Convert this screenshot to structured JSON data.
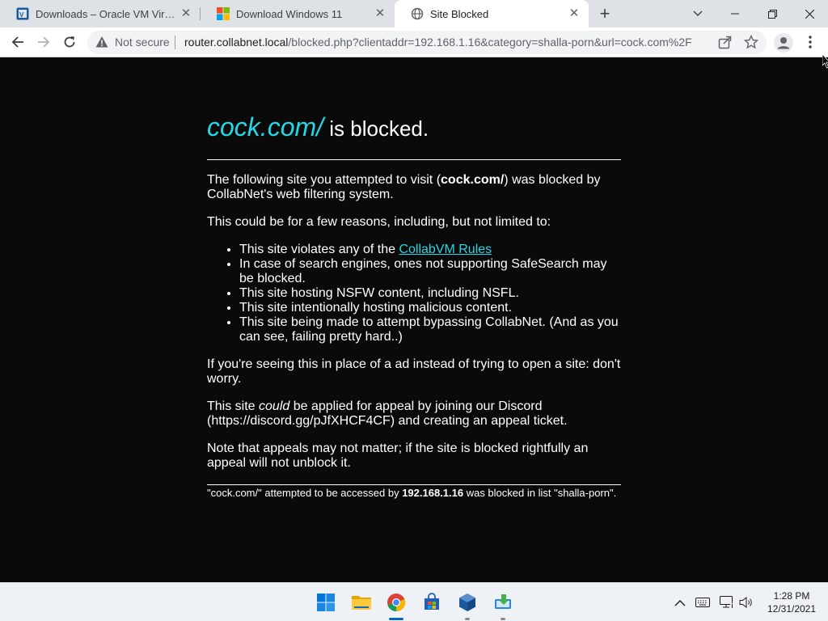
{
  "browser": {
    "tabs": [
      {
        "title": "Downloads – Oracle VM VirtualBox",
        "favicon": "virtualbox-icon",
        "active": false
      },
      {
        "title": "Download Windows 11",
        "favicon": "windows-icon",
        "active": false
      },
      {
        "title": "Site Blocked",
        "favicon": "globe-icon",
        "active": true
      }
    ],
    "address_bar": {
      "security_label": "Not secure",
      "url_host": "router.collabnet.local",
      "url_rest": "/blocked.php?clientaddr=192.168.1.16&category=shalla-porn&url=cock.com%2F"
    }
  },
  "page": {
    "heading_site": "cock.com/",
    "heading_rest": " is blocked.",
    "intro_prefix": "The following site you attempted to visit (",
    "intro_site": "cock.com/",
    "intro_suffix": ") was blocked by CollabNet's web filtering system.",
    "reasons_intro": "This could be for a few reasons, including, but not limited to:",
    "reason1_prefix": "This site violates any of the ",
    "reason1_link": "CollabVM Rules",
    "reason2": "In case of search engines, ones not supporting SafeSearch may be blocked.",
    "reason3": "This site hosting NSFW content, including NSFL.",
    "reason4": "This site intentionally hosting malicious content.",
    "reason5": "This site being made to attempt bypassing CollabNet. (And as you can see, failing pretty hard..)",
    "ad_notice": "If you're seeing this in place of a ad instead of trying to open a site: don't worry.",
    "appeal_prefix": "This site ",
    "appeal_em": "could",
    "appeal_suffix": " be applied for appeal by joining our Discord (https://discord.gg/pJfXHCF4CF) and creating an appeal ticket.",
    "appeal_note": "Note that appeals may not matter; if the site is blocked rightfully an appeal will not unblock it.",
    "footer_prefix": "\"cock.com/\" attempted to be accessed by ",
    "footer_ip": "192.168.1.16",
    "footer_suffix": " was blocked in list \"shalla-porn\"."
  },
  "taskbar": {
    "pinned": [
      "start-icon",
      "file-explorer-icon",
      "chrome-icon",
      "store-icon",
      "virtualbox-icon",
      "app-installer-icon"
    ],
    "tray": [
      "chevron-up-icon",
      "keyboard-icon",
      "network-icon",
      "volume-icon"
    ],
    "time": "1:28 PM",
    "date": "12/31/2021"
  },
  "colors": {
    "accent_cyan": "#22d8e6",
    "page_background": "#0a0a0a",
    "tab_strip": "#dee1e6"
  }
}
